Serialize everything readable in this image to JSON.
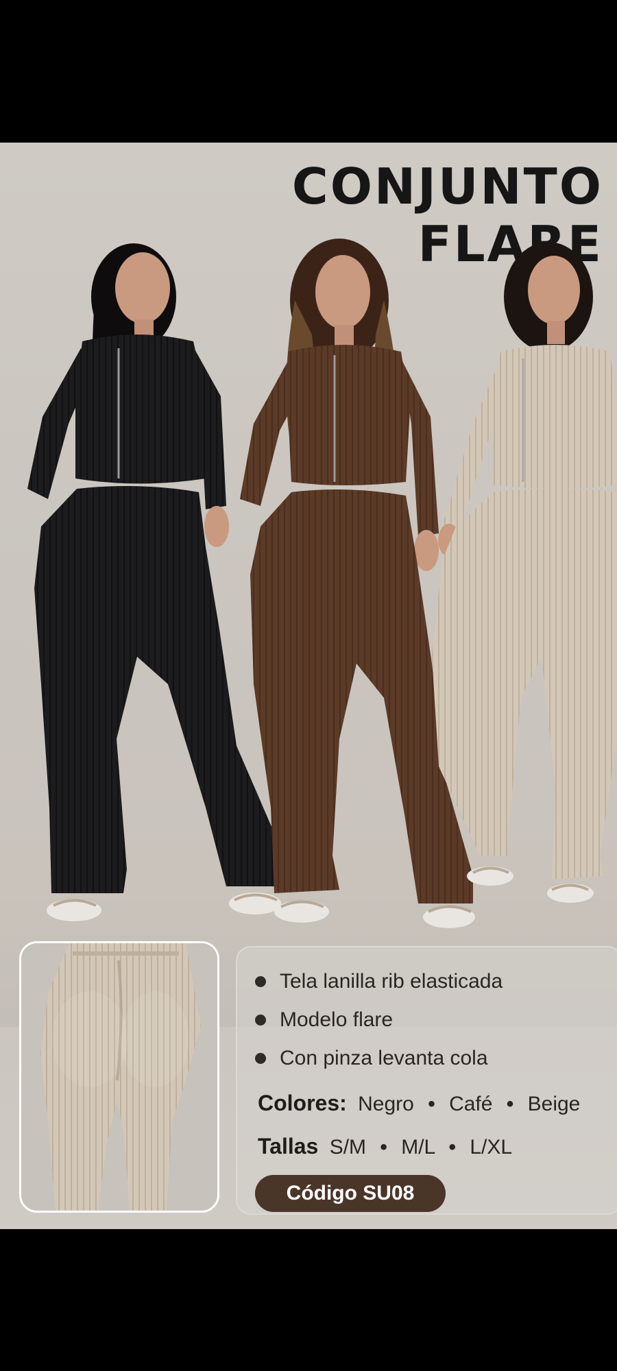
{
  "poster": {
    "title": "CONJUNTO FLARE",
    "features": [
      "Tela lanilla rib elasticada",
      "Modelo flare",
      "Con pinza levanta cola"
    ],
    "colors": {
      "label": "Colores:",
      "values": [
        "Negro",
        "Café",
        "Beige"
      ]
    },
    "sizes": {
      "label": "Tallas",
      "values": [
        "S/M",
        "M/L",
        "L/XL"
      ]
    },
    "code": "Código SU08",
    "separator": "•",
    "bullet": "●"
  },
  "palette": {
    "negro": "#1b1b1d",
    "cafe": "#5a3a26",
    "beige": "#cfc3b1",
    "badge": "#4a3529",
    "background": "#cdc8c2"
  },
  "images": {
    "models_photo": "three-models-in-ribbed-flare-sets",
    "detail_photo": "beige-flare-pants-back-detail"
  }
}
